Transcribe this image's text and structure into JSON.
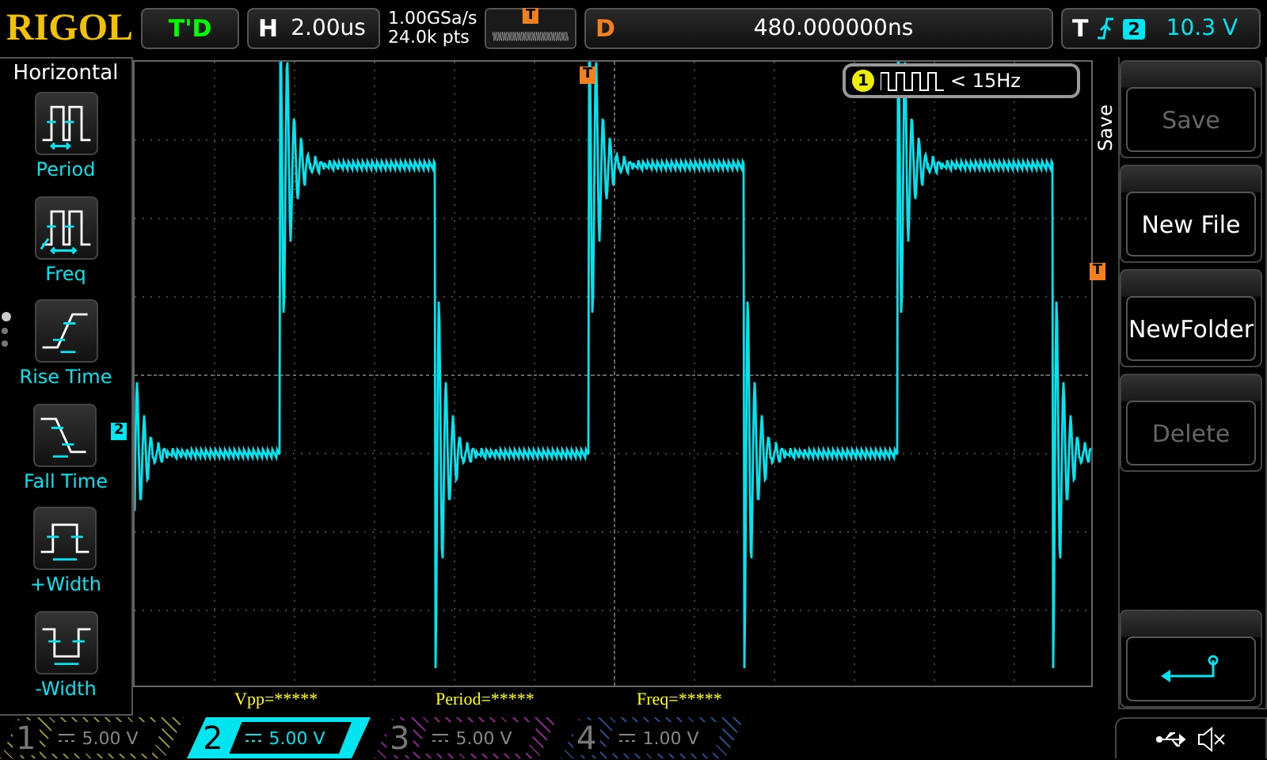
{
  "brand": "RIGOL",
  "run_state": "T'D",
  "horizontal": {
    "label": "H",
    "value": "2.00us"
  },
  "acquisition": {
    "sample_rate": "1.00GSa/s",
    "memory_depth": "24.0k pts"
  },
  "trigger_position_marker": "T",
  "delay": {
    "label": "D",
    "value": "480.000000ns"
  },
  "trigger": {
    "label": "T",
    "channel": "2",
    "level": "10.3 V"
  },
  "left_menu": {
    "title": "Horizontal",
    "items": [
      {
        "label": "Period",
        "kind": "period"
      },
      {
        "label": "Freq",
        "kind": "freq"
      },
      {
        "label": "Rise Time",
        "kind": "rise"
      },
      {
        "label": "Fall Time",
        "kind": "fall"
      },
      {
        "label": "+Width",
        "kind": "pwidth"
      },
      {
        "label": "-Width",
        "kind": "nwidth"
      }
    ],
    "pages": [
      {
        "selected": true
      },
      {
        "selected": false
      },
      {
        "selected": false
      }
    ]
  },
  "screen": {
    "trigger_marker": "T",
    "level_marker": "T",
    "channel_marker": "2",
    "counter": {
      "channel": "1",
      "reading": "< 15Hz"
    }
  },
  "measurements": [
    "Vpp=*****",
    "Period=*****",
    "Freq=*****"
  ],
  "right_menu": {
    "title": "Save",
    "buttons": [
      {
        "kind": "text",
        "label": "Save",
        "disabled": true
      },
      {
        "kind": "text",
        "label": "New File",
        "disabled": false
      },
      {
        "kind": "text",
        "label": "NewFolder",
        "disabled": false
      },
      {
        "kind": "text",
        "label": "Delete",
        "disabled": true
      },
      {
        "kind": "empty"
      },
      {
        "kind": "back"
      }
    ]
  },
  "channels": [
    {
      "number": "1",
      "scale": "5.00 V",
      "color": "#8c8c1e",
      "selected": false
    },
    {
      "number": "2",
      "scale": "5.00 V",
      "color": "#00e5f0",
      "selected": true
    },
    {
      "number": "3",
      "scale": "5.00 V",
      "color": "#8a1e8a",
      "selected": false
    },
    {
      "number": "4",
      "scale": "1.00 V",
      "color": "#1e4a8c",
      "selected": false
    }
  ]
}
